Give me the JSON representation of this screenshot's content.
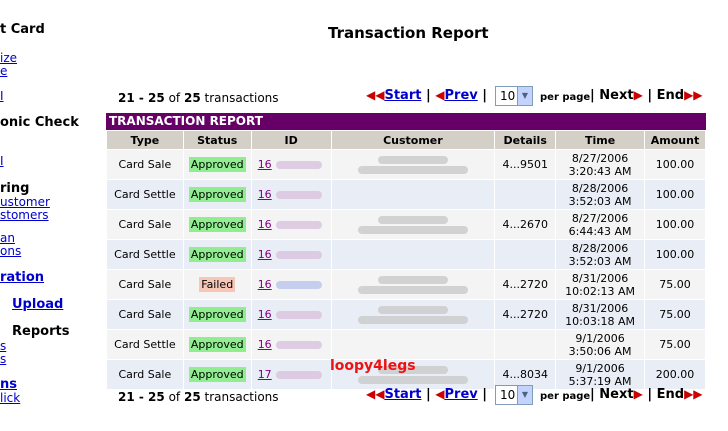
{
  "sidebar": {
    "items": [
      {
        "text": "t Card",
        "kind": "head"
      },
      {
        "text": "ize",
        "kind": "link"
      },
      {
        "text": "e",
        "kind": "link"
      },
      {
        "text": "I",
        "kind": "link"
      },
      {
        "text": "onic Check",
        "kind": "head"
      },
      {
        "text": "I",
        "kind": "link"
      },
      {
        "text": "ring",
        "kind": "head"
      },
      {
        "text": "ustomer",
        "kind": "link"
      },
      {
        "text": "stomers",
        "kind": "link"
      },
      {
        "text": "an",
        "kind": "link"
      },
      {
        "text": "ons",
        "kind": "link"
      },
      {
        "text": "ration",
        "kind": "blink"
      },
      {
        "text": "Upload",
        "kind": "blink"
      },
      {
        "text": "Reports",
        "kind": "head"
      },
      {
        "text": "s",
        "kind": "link"
      },
      {
        "text": "s",
        "kind": "link"
      },
      {
        "text": "ns",
        "kind": "blink"
      },
      {
        "text": "lick",
        "kind": "link"
      }
    ]
  },
  "page": {
    "title": "Transaction Report"
  },
  "pager": {
    "range": "21 - 25",
    "of_label": "of",
    "total": "25",
    "suffix": "transactions",
    "start_label": "Start",
    "prev_label": "Prev",
    "next_label": "Next",
    "end_label": "End",
    "per_page_value": "10",
    "per_page_label": "per page",
    "separator": "|"
  },
  "report": {
    "header": "TRANSACTION REPORT",
    "columns": [
      "Type",
      "Status",
      "ID",
      "Customer",
      "Details",
      "Time",
      "Amount"
    ],
    "rows": [
      {
        "type": "Card Sale",
        "status": "Approved",
        "id": "16",
        "details": "4...9501",
        "date": "8/27/2006",
        "time": "3:20:43 AM",
        "amount": "100.00",
        "has_customer": true
      },
      {
        "type": "Card Settle",
        "status": "Approved",
        "id": "16",
        "details": "",
        "date": "8/28/2006",
        "time": "3:52:03 AM",
        "amount": "100.00",
        "has_customer": false
      },
      {
        "type": "Card Sale",
        "status": "Approved",
        "id": "16",
        "details": "4...2670",
        "date": "8/27/2006",
        "time": "6:44:43 AM",
        "amount": "100.00",
        "has_customer": true
      },
      {
        "type": "Card Settle",
        "status": "Approved",
        "id": "16",
        "details": "",
        "date": "8/28/2006",
        "time": "3:52:03 AM",
        "amount": "100.00",
        "has_customer": false
      },
      {
        "type": "Card Sale",
        "status": "Failed",
        "id": "16",
        "details": "4...2720",
        "date": "8/31/2006",
        "time": "10:02:13 AM",
        "amount": "75.00",
        "has_customer": true
      },
      {
        "type": "Card Sale",
        "status": "Approved",
        "id": "16",
        "details": "4...2720",
        "date": "8/31/2006",
        "time": "10:03:18 AM",
        "amount": "75.00",
        "has_customer": true
      },
      {
        "type": "Card Settle",
        "status": "Approved",
        "id": "16",
        "details": "",
        "date": "9/1/2006",
        "time": "3:50:06 AM",
        "amount": "75.00",
        "has_customer": false
      },
      {
        "type": "Card Sale",
        "status": "Approved",
        "id": "17",
        "details": "4...8034",
        "date": "9/1/2006",
        "time": "5:37:19 AM",
        "amount": "200.00",
        "has_customer": true
      }
    ]
  },
  "watermark": "loopy4legs",
  "colors": {
    "header_bg": "#660066",
    "approved_bg": "#90ee90",
    "failed_bg": "#f7c6b7",
    "link": "#0000cc",
    "arrow": "#cc0000"
  }
}
